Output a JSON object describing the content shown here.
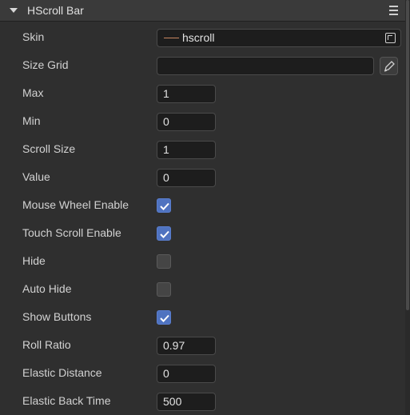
{
  "header": {
    "title": "HScroll Bar",
    "collapse_icon": "caret-down-icon",
    "menu_icon": "menu-icon"
  },
  "skin": {
    "label": "Skin",
    "value": "hscroll",
    "pick_icon": "select-asset-icon"
  },
  "size_grid": {
    "label": "Size Grid",
    "value": "",
    "edit_icon": "edit-pen-icon"
  },
  "max": {
    "label": "Max",
    "value": "1"
  },
  "min": {
    "label": "Min",
    "value": "0"
  },
  "scroll_size": {
    "label": "Scroll Size",
    "value": "1"
  },
  "value": {
    "label": "Value",
    "value": "0"
  },
  "mouse_wheel_enable": {
    "label": "Mouse Wheel Enable",
    "checked": true
  },
  "touch_scroll_enable": {
    "label": "Touch Scroll Enable",
    "checked": true
  },
  "hide": {
    "label": "Hide",
    "checked": false
  },
  "auto_hide": {
    "label": "Auto Hide",
    "checked": false
  },
  "show_buttons": {
    "label": "Show Buttons",
    "checked": true
  },
  "roll_ratio": {
    "label": "Roll Ratio",
    "value": "0.97"
  },
  "elastic_distance": {
    "label": "Elastic Distance",
    "value": "0"
  },
  "elastic_back_time": {
    "label": "Elastic Back Time",
    "value": "500"
  },
  "colors": {
    "checkbox_on": "#4f73c0",
    "checkbox_off": "#454545",
    "skin_swatch": "#c88760"
  }
}
